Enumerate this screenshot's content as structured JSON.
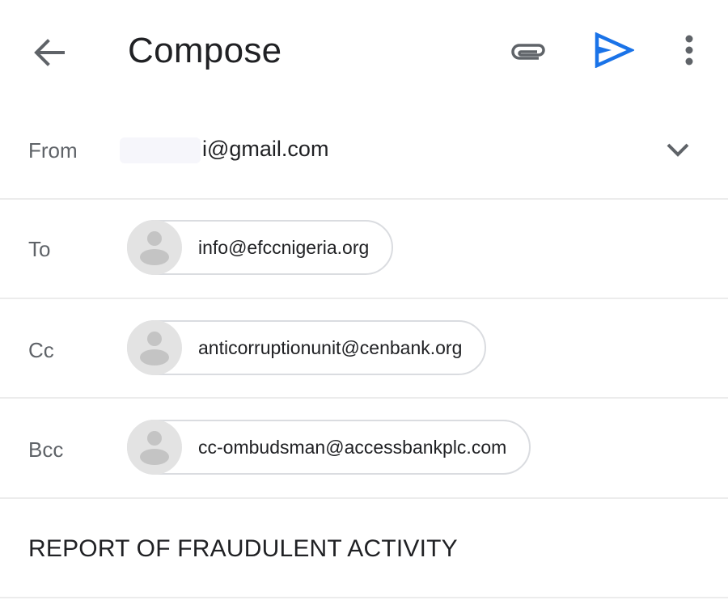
{
  "appbar": {
    "title": "Compose",
    "icons": {
      "back": "arrow-back-icon",
      "attach": "paperclip-icon",
      "send": "send-icon",
      "more": "more-vert-icon"
    },
    "send_color": "#1a73e8"
  },
  "from": {
    "label": "From",
    "value_visible": "i@gmail.com",
    "redacted": true
  },
  "to": {
    "label": "To",
    "recipients": [
      "info@efccnigeria.org"
    ]
  },
  "cc": {
    "label": "Cc",
    "recipients": [
      "anticorruptionunit@cenbank.org"
    ]
  },
  "bcc": {
    "label": "Bcc",
    "recipients": [
      "cc-ombudsman@accessbankplc.com"
    ]
  },
  "subject": {
    "value": "REPORT OF FRAUDULENT ACTIVITY"
  }
}
